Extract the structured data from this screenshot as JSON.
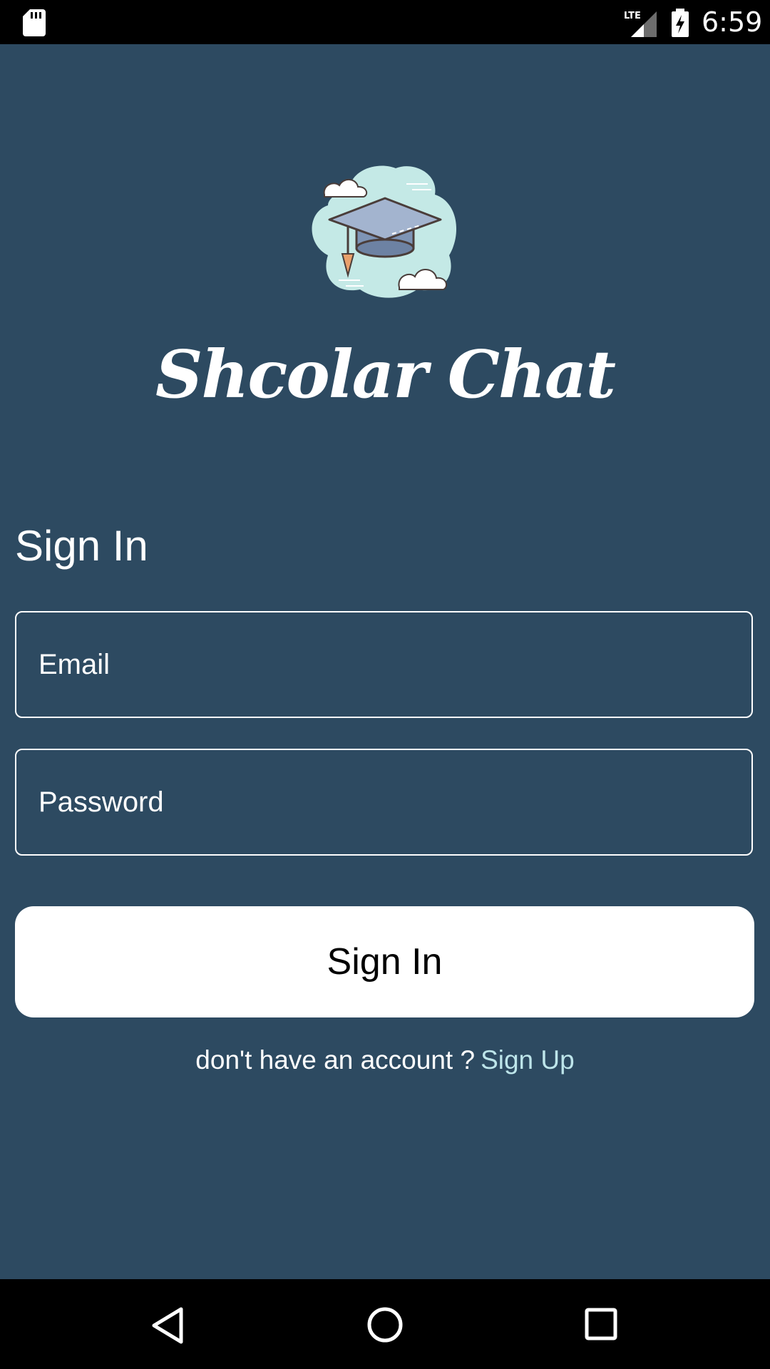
{
  "status_bar": {
    "time": "6:59",
    "network_label": "LTE",
    "icons": [
      "sd-card-icon",
      "lte-signal-icon",
      "battery-charging-icon"
    ]
  },
  "app": {
    "title": "Shcolar Chat",
    "logo_icon": "graduation-cap-cloud-icon"
  },
  "form": {
    "heading": "Sign In",
    "email_placeholder": "Email",
    "password_placeholder": "Password",
    "submit_label": "Sign In",
    "signup_prompt": "don't have an account ?",
    "signup_link": "Sign Up"
  },
  "nav_bar": {
    "icons": [
      "back-icon",
      "home-icon",
      "recents-icon"
    ]
  },
  "colors": {
    "background": "#2d4a61",
    "link": "#bde5ea",
    "button": "#ffffff",
    "text": "#ffffff"
  }
}
